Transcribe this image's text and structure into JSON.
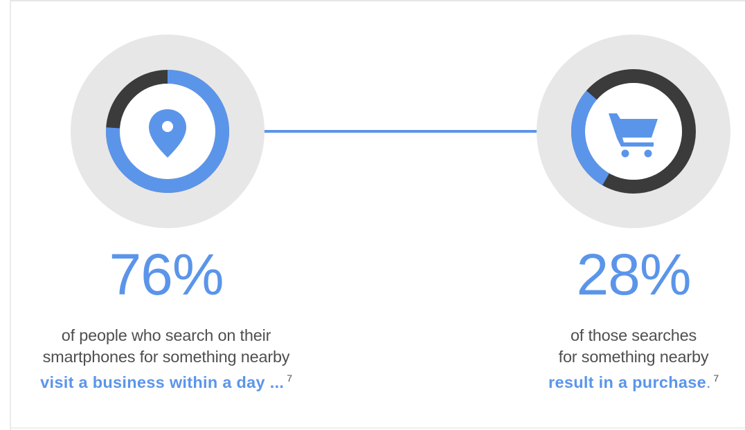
{
  "colors": {
    "accent": "#5b95ea",
    "dark": "#3b3b3b",
    "halo": "#e7e7e7",
    "text": "#4f4f4f"
  },
  "chart_data": [
    {
      "type": "pie",
      "icon": "map-pin-icon",
      "value": 76,
      "value_label": "76%",
      "description": [
        "of people who search on their",
        "smartphones for something nearby"
      ],
      "highlight": "visit a business within a day ...",
      "footnote": "7"
    },
    {
      "type": "pie",
      "icon": "shopping-cart-icon",
      "value": 28,
      "value_label": "28%",
      "description": [
        "of those searches",
        "for something nearby"
      ],
      "highlight": "result in a purchase",
      "highlight_suffix": ".",
      "footnote": "7"
    }
  ]
}
